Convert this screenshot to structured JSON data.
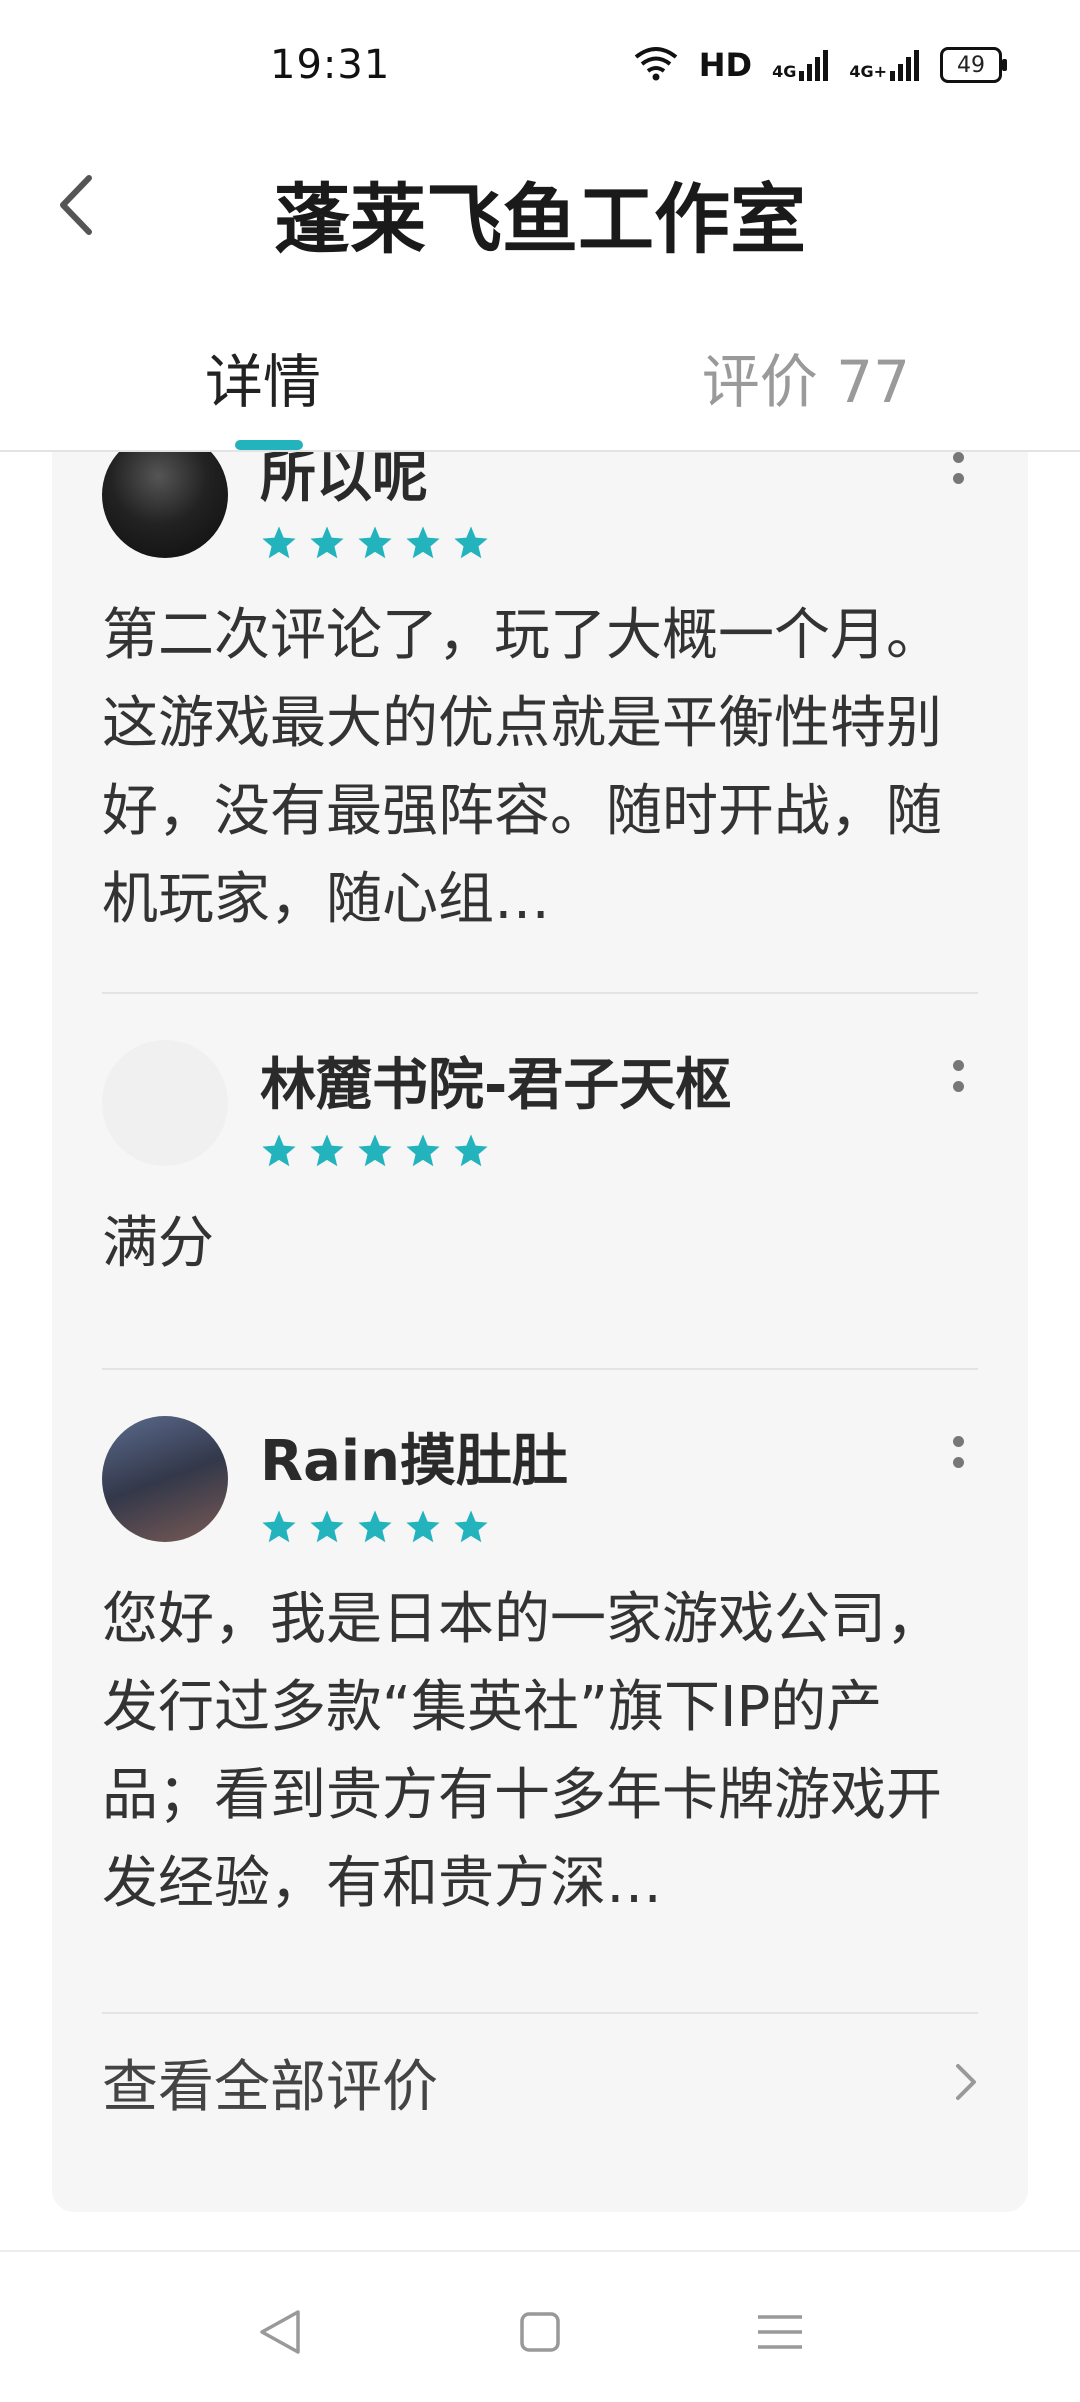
{
  "status_bar": {
    "time": "19:31",
    "network_label": "HD",
    "signal1_label": "4G",
    "signal2_label": "4G+",
    "battery": "49",
    "icons": [
      "wifi-icon",
      "signal-icon",
      "signal-icon",
      "battery-icon"
    ]
  },
  "header": {
    "title": "蓬莱飞鱼工作室",
    "back_icon": "chevron-left-icon"
  },
  "tabs": [
    {
      "label": "详情",
      "active": true
    },
    {
      "label": "评价 77",
      "active": false
    }
  ],
  "colors": {
    "accent": "#23b3bd",
    "card_bg": "#f6f6f6",
    "star": "#23b3bd"
  },
  "reviews": [
    {
      "name": "所以呢",
      "rating": 5,
      "text": "第二次评论了，玩了大概一个月。这游戏最大的优点就是平衡性特别好，没有最强阵容。随时开战，随机玩家，随心组…"
    },
    {
      "name": "林麓书院-君子天枢",
      "rating": 5,
      "text": "满分"
    },
    {
      "name": "Rain摸肚肚",
      "rating": 5,
      "text": "您好，我是日本的一家游戏公司，发行过多款“集英社”旗下IP的产品；看到贵方有十多年卡牌游戏开发经验，有和贵方深…"
    }
  ],
  "see_all": {
    "label": "查看全部评价",
    "icon": "chevron-right-icon"
  },
  "nav_bar": {
    "items": [
      "back-triangle-icon",
      "home-square-icon",
      "menu-lines-icon"
    ]
  }
}
